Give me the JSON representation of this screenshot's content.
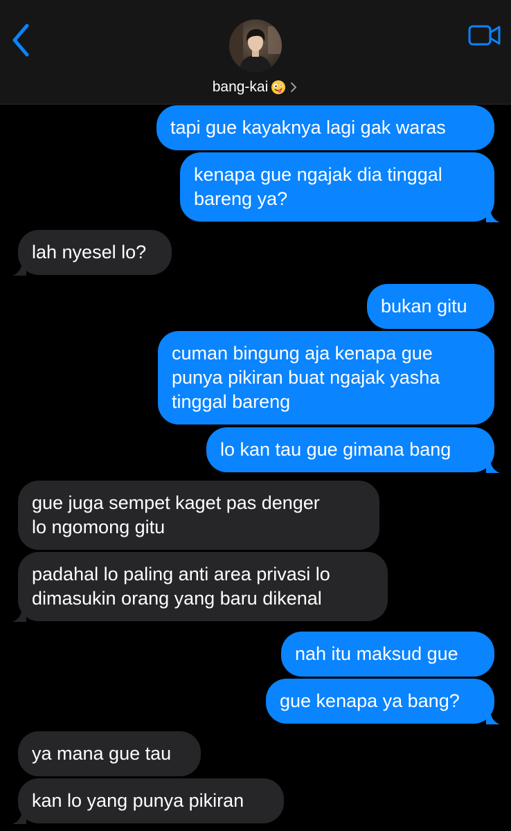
{
  "header": {
    "contact_name": "bang-kai",
    "contact_emoji_icon": "zany-face-emoji-icon",
    "chevron_icon": "chevron-right-icon",
    "back_icon": "chevron-left-back-icon",
    "video_icon": "video-camera-icon"
  },
  "colors": {
    "sent_bubble": "#0A84FF",
    "received_bubble": "#262628",
    "accent": "#0A84FF",
    "background": "#000000"
  },
  "messages": [
    {
      "from": "me",
      "text": "tapi gue kayaknya lagi gak waras"
    },
    {
      "from": "me",
      "text_lines": [
        "kenapa gue ngajak dia tinggal",
        "bareng ya?"
      ]
    },
    {
      "from": "them",
      "text": "lah nyesel lo?"
    },
    {
      "from": "me",
      "text": "bukan gitu"
    },
    {
      "from": "me",
      "text_lines": [
        "cuman bingung aja kenapa gue",
        "punya pikiran buat ngajak yasha",
        "tinggal bareng"
      ]
    },
    {
      "from": "me",
      "text": "lo kan tau gue gimana bang"
    },
    {
      "from": "them",
      "text_lines": [
        "gue juga sempet kaget pas denger",
        "lo ngomong gitu"
      ]
    },
    {
      "from": "them",
      "text_lines": [
        "padahal lo paling anti area privasi lo",
        "dimasukin orang yang baru dikenal"
      ]
    },
    {
      "from": "me",
      "text": "nah itu maksud gue"
    },
    {
      "from": "me",
      "text": "gue kenapa ya bang?"
    },
    {
      "from": "them",
      "text": "ya mana gue tau"
    },
    {
      "from": "them",
      "text": "kan lo yang punya pikiran"
    }
  ]
}
